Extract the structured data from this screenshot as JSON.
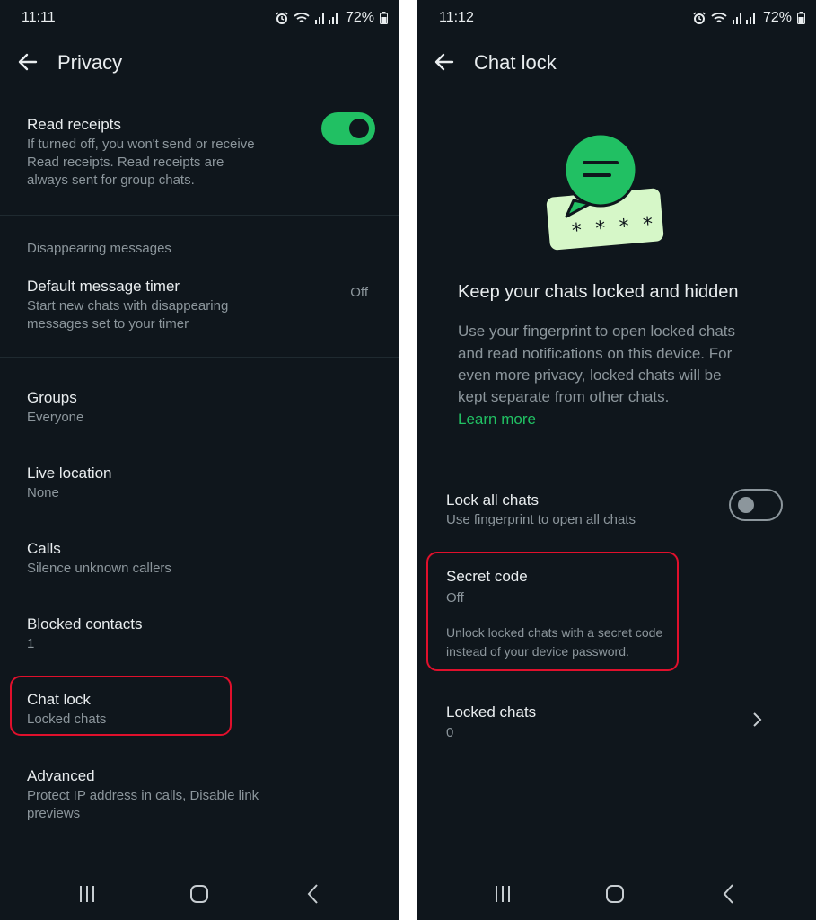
{
  "left": {
    "status": {
      "time": "11:11",
      "battery": "72%"
    },
    "header": {
      "title": "Privacy"
    },
    "read_receipts": {
      "title": "Read receipts",
      "description_lines": [
        "If turned off, you won't send or receive",
        "Read receipts. Read receipts are",
        "always sent for group chats."
      ],
      "enabled": true
    },
    "disappearing": {
      "section_label": "Disappearing messages",
      "timer_title": "Default message timer",
      "timer_desc_lines": [
        "Start new chats with disappearing",
        "messages set to your timer"
      ],
      "timer_value": "Off"
    },
    "items": [
      {
        "title": "Groups",
        "subtitle": "Everyone"
      },
      {
        "title": "Live location",
        "subtitle": "None"
      },
      {
        "title": "Calls",
        "subtitle": "Silence unknown callers"
      },
      {
        "title": "Blocked contacts",
        "subtitle": "1"
      },
      {
        "title": "Chat lock",
        "subtitle": "Locked chats"
      }
    ],
    "advanced": {
      "title": "Advanced",
      "subtitle_lines": [
        "Protect IP address in calls, Disable link",
        "previews"
      ]
    }
  },
  "right": {
    "status": {
      "time": "11:12",
      "battery": "72%"
    },
    "header": {
      "title": "Chat lock"
    },
    "illustration": {
      "code_mask": "* * * *"
    },
    "hero": {
      "title": "Keep your chats locked and hidden",
      "body_lines": [
        "Use your fingerprint to open locked chats",
        "and read notifications on this device. For",
        "even more privacy, locked chats will be",
        "kept separate from other chats."
      ],
      "learn_more": "Learn more"
    },
    "lock_all": {
      "title": "Lock all chats",
      "subtitle": "Use fingerprint to open all chats",
      "enabled": false
    },
    "secret_code": {
      "title": "Secret code",
      "value": "Off",
      "desc_lines": [
        "Unlock locked chats with a secret code",
        "instead of your device password."
      ]
    },
    "locked_chats": {
      "title": "Locked chats",
      "count": "0"
    }
  },
  "colors": {
    "background": "#0f161c",
    "accent": "#21c063",
    "highlight": "#e0102c",
    "text_secondary": "#8c969c"
  },
  "icons": {
    "status": [
      "alarm-icon",
      "wifi-icon",
      "signal-icon",
      "battery-icon"
    ],
    "navigation": [
      "recent-apps-icon",
      "home-icon",
      "back-nav-icon"
    ]
  }
}
